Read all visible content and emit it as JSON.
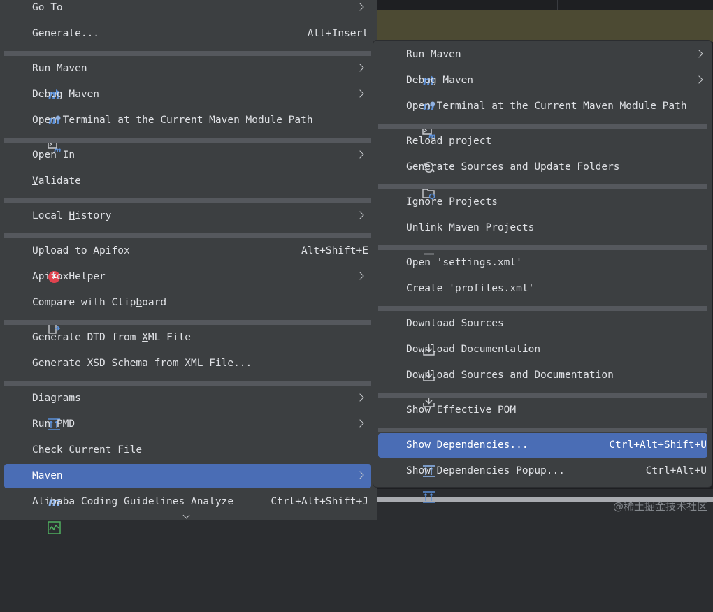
{
  "main_menu": {
    "goto": {
      "label": "Go To"
    },
    "generate": {
      "label": "Generate...",
      "shortcut": "Alt+Insert"
    },
    "run_maven": {
      "label": "Run Maven"
    },
    "debug_maven": {
      "label": "Debug Maven"
    },
    "open_terminal": {
      "label": "Open Terminal at the Current Maven Module Path"
    },
    "open_in": {
      "label": "Open In"
    },
    "validate": {
      "label_pre": "",
      "label_u": "V",
      "label_post": "alidate"
    },
    "local_history": {
      "label_pre": "Local ",
      "label_u": "H",
      "label_post": "istory"
    },
    "upload_apifox": {
      "label": "Upload to Apifox",
      "shortcut": "Alt+Shift+E"
    },
    "apifox_helper": {
      "label": "ApifoxHelper"
    },
    "compare_clipboard": {
      "label_pre": "Compare with Clip",
      "label_u": "b",
      "label_post": "oard"
    },
    "generate_dtd": {
      "label_pre": "Generate DTD from ",
      "label_u": "X",
      "label_post": "ML File"
    },
    "generate_xsd": {
      "label": "Generate XSD Schema from XML File..."
    },
    "diagrams": {
      "label": "Diagrams"
    },
    "run_pmd": {
      "label": "Run PMD"
    },
    "check_current_file": {
      "label": "Check Current File"
    },
    "maven": {
      "label": "Maven"
    },
    "alibaba": {
      "label": "Alibaba Coding Guidelines Analyze",
      "shortcut": "Ctrl+Alt+Shift+J"
    }
  },
  "sub_menu": {
    "run_maven": {
      "label": "Run Maven"
    },
    "debug_maven": {
      "label": "Debug Maven"
    },
    "open_terminal": {
      "label": "Open Terminal at the Current Maven Module Path"
    },
    "reload_project": {
      "label": "Reload project"
    },
    "generate_sources": {
      "label": "Generate Sources and Update Folders"
    },
    "ignore_projects": {
      "label": "Ignore Projects"
    },
    "unlink_projects": {
      "label": "Unlink Maven Projects"
    },
    "open_settings": {
      "label": "Open 'settings.xml'"
    },
    "create_profiles": {
      "label": "Create 'profiles.xml'"
    },
    "download_sources": {
      "label": "Download Sources"
    },
    "download_docs": {
      "label": "Download Documentation"
    },
    "download_both": {
      "label": "Download Sources and Documentation"
    },
    "show_effective_pom": {
      "label": "Show Effective POM"
    },
    "show_dependencies": {
      "label": "Show Dependencies...",
      "shortcut": "Ctrl+Alt+Shift+U"
    },
    "show_dependencies_popup": {
      "label": "Show Dependencies Popup...",
      "shortcut": "Ctrl+Alt+U"
    }
  },
  "icons": {
    "maven_letter": "m",
    "terminal_glyph": "▣",
    "reload_glyph": "⟳",
    "upload_glyph": "⌃",
    "compare_glyph": "⇄",
    "unlink_glyph": "—"
  },
  "watermark": "@稀土掘金技术社区",
  "colors": {
    "menu_bg": "#3c3f41",
    "selected_bg": "#4a6db5",
    "separator": "#55585d",
    "maven_blue": "#5a8fd8",
    "apifox_red": "#e0434f",
    "check_green": "#4fae5f"
  }
}
